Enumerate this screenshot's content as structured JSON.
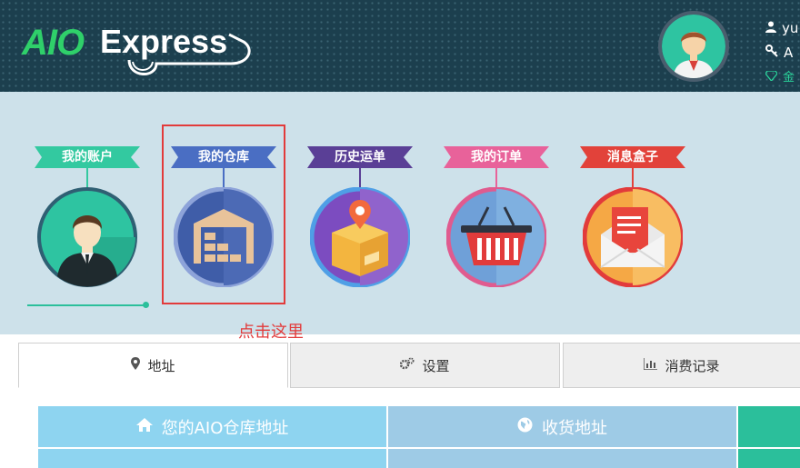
{
  "header": {
    "logo_text": "AIO Express",
    "user": {
      "name": "yu",
      "account": "A",
      "level": "金"
    }
  },
  "nav": {
    "items": [
      {
        "label": "我的账户",
        "ribbon_color": "#33c9a0",
        "ring_color": "#2f5f73",
        "bg_color": "#2ec4a1",
        "icon": "user-avatar-icon"
      },
      {
        "label": "我的仓库",
        "ribbon_color": "#4a6ec3",
        "ring_color": "#7f99d6",
        "bg_color": "#3f5da8",
        "icon": "warehouse-icon"
      },
      {
        "label": "历史运单",
        "ribbon_color": "#5a3f96",
        "ring_color": "#4f9fe6",
        "bg_color": "#7c4cc0",
        "icon": "package-location-icon"
      },
      {
        "label": "我的订单",
        "ribbon_color": "#e8629a",
        "ring_color": "#e05b8f",
        "bg_color": "#6fa0d8",
        "icon": "shopping-basket-icon"
      },
      {
        "label": "消息盒子",
        "ribbon_color": "#e2423a",
        "ring_color": "#e23b3b",
        "bg_color": "#f5a845",
        "icon": "mail-icon"
      }
    ],
    "annotation": "点击这里"
  },
  "tabs": [
    {
      "label": "地址",
      "icon": "map-marker-icon",
      "active": true
    },
    {
      "label": "设置",
      "icon": "gears-icon",
      "active": false
    },
    {
      "label": "消费记录",
      "icon": "bar-chart-icon",
      "active": false
    }
  ],
  "table": {
    "headers": [
      {
        "label": "您的AIO仓库地址",
        "icon": "home-icon",
        "color": "#8ed4f0"
      },
      {
        "label": "收货地址",
        "icon": "globe-icon",
        "color": "#9ecbe6"
      },
      {
        "label": "",
        "icon": "",
        "color": "#2bbf9b"
      }
    ]
  }
}
